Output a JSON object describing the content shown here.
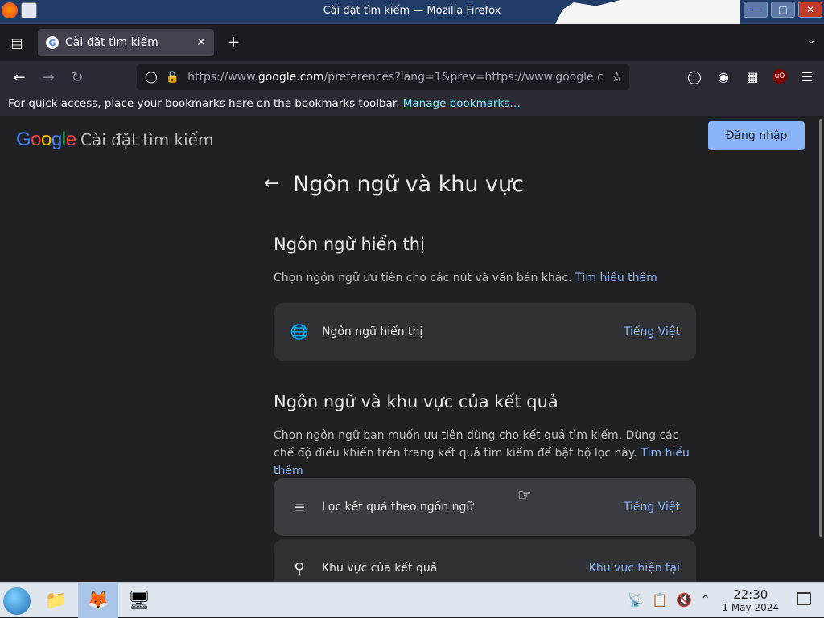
{
  "window": {
    "title": "Cài đặt tìm kiếm — Mozilla Firefox",
    "minimize_icon": "minimize-icon",
    "maximize_icon": "maximize-icon",
    "close_icon": "close-icon"
  },
  "tabs": [
    {
      "label": "Cài đặt tìm kiếm",
      "favicon": "G"
    }
  ],
  "newtab_label": "+",
  "navbar": {
    "url_host_prefix": "https://www.",
    "url_host": "google.com",
    "url_path": "/preferences?lang=1&prev=https://www.google.c"
  },
  "bookmarks": {
    "message": "For quick access, place your bookmarks here on the bookmarks toolbar.",
    "link": "Manage bookmarks…"
  },
  "header": {
    "logo": [
      "G",
      "o",
      "o",
      "g",
      "l",
      "e"
    ],
    "title": "Cài đặt tìm kiếm",
    "signin": "Đăng nhập"
  },
  "page": {
    "title": "Ngôn ngữ và khu vực"
  },
  "display_language": {
    "heading": "Ngôn ngữ hiển thị",
    "description": "Chọn ngôn ngữ ưu tiên cho các nút và văn bản khác.",
    "learn_more": "Tìm hiểu thêm",
    "row_label": "Ngôn ngữ hiển thị",
    "row_value": "Tiếng Việt"
  },
  "results_language": {
    "heading": "Ngôn ngữ và khu vực của kết quả",
    "description": "Chọn ngôn ngữ bạn muốn ưu tiên dùng cho kết quả tìm kiếm. Dùng các chế độ điều khiển trên trang kết quả tìm kiếm để bật bộ lọc này.",
    "learn_more": "Tìm hiểu thêm",
    "filter_label": "Lọc kết quả theo ngôn ngữ",
    "filter_value": "Tiếng Việt",
    "region_label": "Khu vực của kết quả",
    "region_value": "Khu vực hiện tại"
  },
  "taskbar": {
    "time": "22:30",
    "date": "1 May 2024"
  }
}
